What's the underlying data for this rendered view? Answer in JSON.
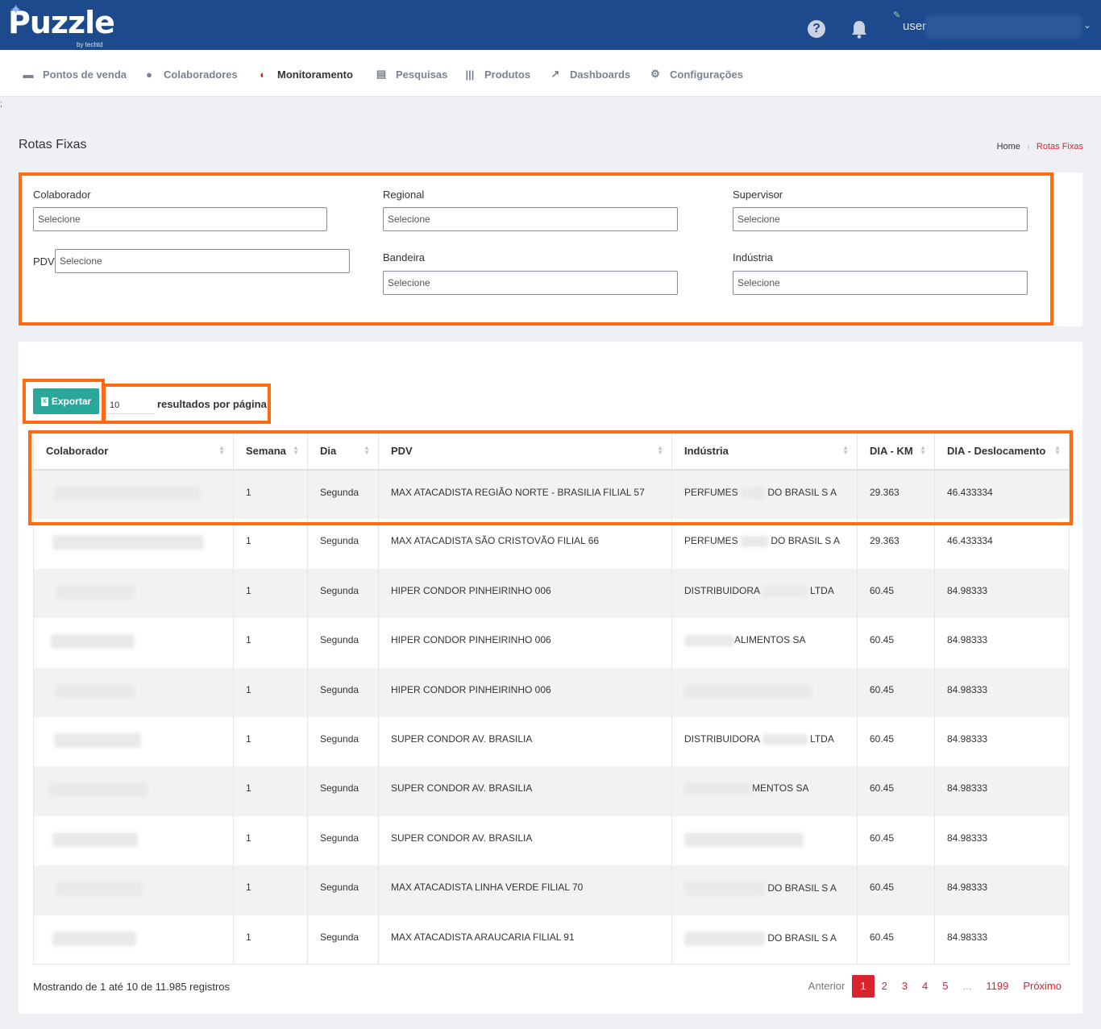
{
  "header": {
    "logo_text": "Puzzle",
    "logo_sub": "by techtd",
    "help_icon": "question-circle-icon",
    "bell_icon": "bell-icon",
    "user_label": "user",
    "user_caret": "chevron-down-icon",
    "colors": {
      "bar": "#1c4a8c",
      "accent": "#d9232d",
      "export": "#2ba69a",
      "highlight": "#ff6a13"
    }
  },
  "nav": {
    "items": [
      {
        "label": "Pontos de venda",
        "icon": "store-icon"
      },
      {
        "label": "Colaboradores",
        "icon": "users-icon"
      },
      {
        "label": "Monitoramento",
        "icon": "monitor-icon"
      },
      {
        "label": "Pesquisas",
        "icon": "survey-icon"
      },
      {
        "label": "Produtos",
        "icon": "barcode-icon"
      },
      {
        "label": "Dashboards",
        "icon": "chart-icon"
      },
      {
        "label": "Configurações",
        "icon": "gears-icon"
      }
    ]
  },
  "stray_text": ";",
  "page": {
    "title": "Rotas Fixas",
    "breadcrumb": {
      "home": "Home",
      "current": "Rotas Fixas"
    }
  },
  "filters": {
    "colaborador": {
      "label": "Colaborador",
      "value": "Selecione"
    },
    "regional": {
      "label": "Regional",
      "value": "Selecione"
    },
    "supervisor": {
      "label": "Supervisor",
      "value": "Selecione"
    },
    "pdv": {
      "label": "PDV",
      "value": "Selecione"
    },
    "bandeira": {
      "label": "Bandeira",
      "value": "Selecione"
    },
    "industria": {
      "label": "Indústria",
      "value": "Selecione"
    }
  },
  "toolbar": {
    "export_label": "Exportar",
    "per_page_value": "10",
    "per_page_label": "resultados por página"
  },
  "table": {
    "columns": [
      "Colaborador",
      "Semana",
      "Dia",
      "PDV",
      "Indústria",
      "DIA - KM",
      "DIA - Deslocamento"
    ],
    "rows": [
      {
        "semana": "1",
        "dia": "Segunda",
        "pdv": "MAX ATACADISTA REGIÃO NORTE - BRASILIA FILIAL 57",
        "ind_pre": "PERFUMES",
        "ind_post": "DO BRASIL S A",
        "km": "29.363",
        "desloc": "46.433334"
      },
      {
        "semana": "1",
        "dia": "Segunda",
        "pdv": "MAX ATACADISTA SÃO CRISTOVÃO FILIAL 66",
        "ind_pre": "PERFUMES",
        "ind_post": "DO BRASIL S A",
        "km": "29.363",
        "desloc": "46.433334"
      },
      {
        "semana": "1",
        "dia": "Segunda",
        "pdv": "HIPER CONDOR PINHEIRINHO 006",
        "ind_pre": "DISTRIBUIDORA",
        "ind_post": "LTDA",
        "km": "60.45",
        "desloc": "84.98333"
      },
      {
        "semana": "1",
        "dia": "Segunda",
        "pdv": "HIPER CONDOR PINHEIRINHO 006",
        "ind_pre": "",
        "ind_post": "ALIMENTOS SA",
        "km": "60.45",
        "desloc": "84.98333"
      },
      {
        "semana": "1",
        "dia": "Segunda",
        "pdv": "HIPER CONDOR PINHEIRINHO 006",
        "ind_pre": "",
        "ind_post": "",
        "km": "60.45",
        "desloc": "84.98333"
      },
      {
        "semana": "1",
        "dia": "Segunda",
        "pdv": "SUPER CONDOR AV. BRASILIA",
        "ind_pre": "DISTRIBUIDORA",
        "ind_post": "LTDA",
        "km": "60.45",
        "desloc": "84.98333"
      },
      {
        "semana": "1",
        "dia": "Segunda",
        "pdv": "SUPER CONDOR AV. BRASILIA",
        "ind_pre": "",
        "ind_post": "MENTOS SA",
        "km": "60.45",
        "desloc": "84.98333"
      },
      {
        "semana": "1",
        "dia": "Segunda",
        "pdv": "SUPER CONDOR AV. BRASILIA",
        "ind_pre": "",
        "ind_post": "",
        "km": "60.45",
        "desloc": "84.98333"
      },
      {
        "semana": "1",
        "dia": "Segunda",
        "pdv": "MAX ATACADISTA LINHA VERDE FILIAL 70",
        "ind_pre": "",
        "ind_post": "DO BRASIL S A",
        "km": "60.45",
        "desloc": "84.98333"
      },
      {
        "semana": "1",
        "dia": "Segunda",
        "pdv": "MAX ATACADISTA ARAUCARIA FILIAL 91",
        "ind_pre": "",
        "ind_post": "DO BRASIL S A",
        "km": "60.45",
        "desloc": "84.98333"
      }
    ]
  },
  "footer": {
    "info": "Mostrando de 1 até 10 de 11.985 registros",
    "pager": [
      "Anterior",
      "1",
      "2",
      "3",
      "4",
      "5",
      "...",
      "1199",
      "Próximo"
    ]
  }
}
